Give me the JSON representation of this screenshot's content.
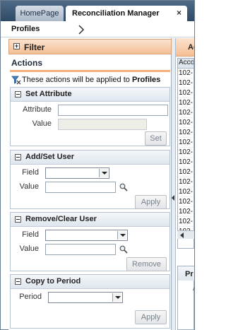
{
  "tabs": [
    {
      "label": "HomePage",
      "active": false
    },
    {
      "label": "Reconciliation Manager",
      "active": true,
      "close_glyph": "×"
    }
  ],
  "breadcrumb": {
    "label": "Profiles",
    "icon": "chevron-right-icon"
  },
  "left_panel": {
    "filter": {
      "label": "Filter",
      "expand_glyph": "+"
    },
    "actions": {
      "title": "Actions",
      "note_prefix": "These actions will be applied to ",
      "note_target": "Profiles",
      "note_icon": "funnel-icon"
    },
    "sections": {
      "set_attribute": {
        "title": "Set Attribute",
        "attribute_label": "Attribute",
        "attribute_value": "",
        "value_label": "Value",
        "value_value": "",
        "button": "Set"
      },
      "add_set_user": {
        "title": "Add/Set User",
        "field_label": "Field",
        "field_selected": "",
        "value_label": "Value",
        "value_value": "",
        "button": "Apply"
      },
      "remove_clear_user": {
        "title": "Remove/Clear User",
        "field_label": "Field",
        "field_selected": "",
        "value_label": "Value",
        "value_value": "",
        "button": "Remove"
      },
      "copy_to_period": {
        "title": "Copy to Period",
        "period_label": "Period",
        "period_selected": "",
        "button": "Apply"
      }
    }
  },
  "right_panel": {
    "tab_label": "Ac",
    "column_header": "Acco",
    "rows": [
      "102-",
      "102-",
      "102-",
      "102-",
      "102-",
      "102-",
      "102-",
      "102-",
      "102-",
      "102-",
      "102-",
      "102-",
      "102-",
      "102-",
      "102-",
      "102-",
      "102-"
    ],
    "lower_title": "Pr",
    "lower_sub": "A"
  },
  "colors": {
    "tabbar": "#3d5a78",
    "filter_bar": "#f4bf93",
    "actions_underline": "#f0b080",
    "section_header": "#dfe6ee"
  }
}
